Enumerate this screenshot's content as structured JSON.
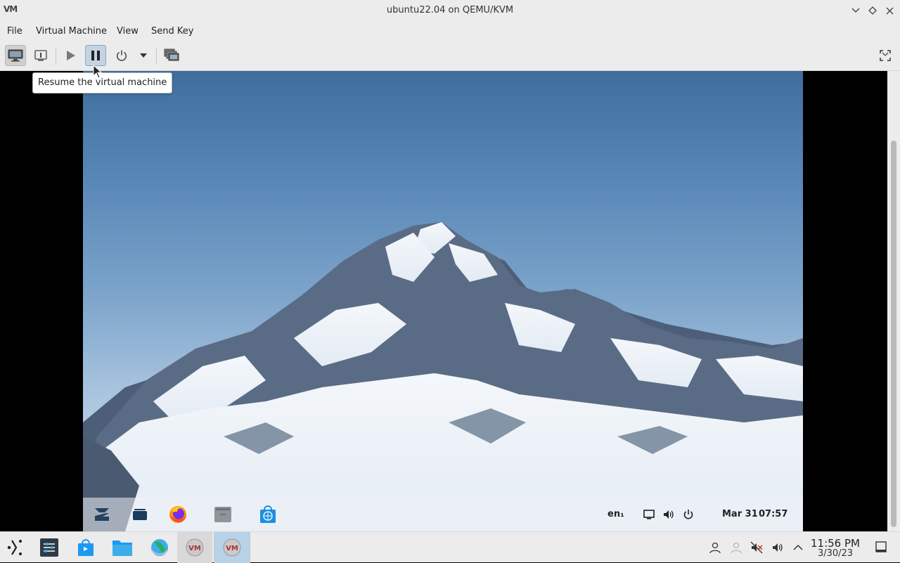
{
  "window": {
    "title": "ubuntu22.04 on QEMU/KVM",
    "app_icon_text": "VM"
  },
  "menubar": {
    "items": [
      "File",
      "Virtual Machine",
      "View",
      "Send Key"
    ]
  },
  "toolbar": {
    "tooltip": "Resume the virtual machine",
    "buttons": [
      {
        "name": "console",
        "icon": "monitor-icon",
        "active": true
      },
      {
        "name": "details",
        "icon": "info-icon",
        "active": false
      },
      {
        "name": "run",
        "icon": "play-icon",
        "active": false
      },
      {
        "name": "pause",
        "icon": "pause-icon",
        "active": true
      },
      {
        "name": "shutdown",
        "icon": "power-icon",
        "active": false
      },
      {
        "name": "shutdown-menu",
        "icon": "dropdown-arrow-icon",
        "active": false
      },
      {
        "name": "screens",
        "icon": "snapshots-icon",
        "active": false
      },
      {
        "name": "fullscreen",
        "icon": "fullscreen-icon",
        "active": false
      }
    ]
  },
  "guest": {
    "panel": {
      "language": "en₁",
      "date": "Mar 31",
      "time": "07:57"
    }
  },
  "taskbar": {
    "clock_time": "11:56 PM",
    "clock_date": "3/30/23",
    "vm_icon_text": "VM"
  },
  "colors": {
    "chrome": "#ececec",
    "pause_active": "#c4d3e2",
    "taskbar_active": "#b7d1e6",
    "sky_top": "#3f6d9c",
    "sky_bottom": "#d8e4ef"
  }
}
